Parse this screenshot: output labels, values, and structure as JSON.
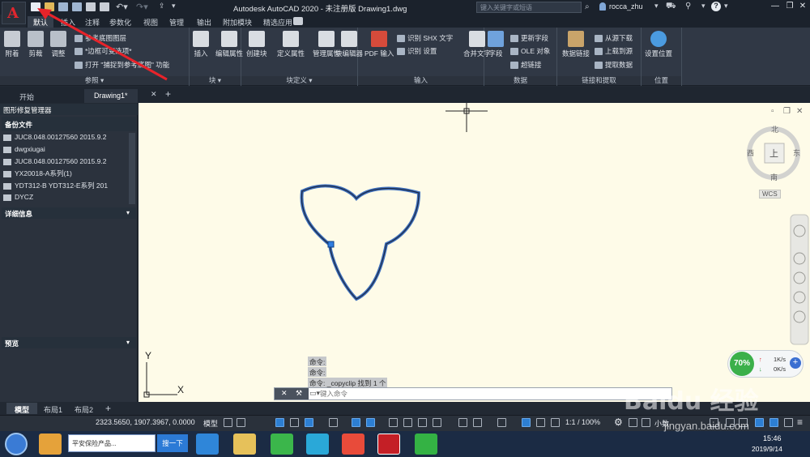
{
  "title": {
    "app_title": "Autodesk AutoCAD 2020 - 未注册版    Drawing1.dwg",
    "search_placeholder": "键入关键字或短语",
    "user": "rocca_zhu"
  },
  "ribbon_tabs": [
    "默认",
    "插入",
    "注释",
    "参数化",
    "视图",
    "管理",
    "输出",
    "附加模块",
    "精选应用"
  ],
  "ribbon": {
    "reference": {
      "title": "参照",
      "attach": "附着",
      "clip": "剪裁",
      "adjust": "调整",
      "underlay_layers": "参考底图图层",
      "frames": "*边框可变选项*",
      "snap": "打开 \"捕捉到参考底图\" 功能"
    },
    "block": {
      "title": "块",
      "insert": "插入",
      "edit_attributes": "编辑属性"
    },
    "block_def": {
      "title": "块定义",
      "create": "创建块",
      "define_attributes": "定义属性",
      "manage_attributes": "管理属性",
      "block_editor": "块编辑器"
    },
    "import": {
      "title": "输入",
      "pdf_import": "PDF 输入",
      "recognize_shx": "识别 SHX 文字",
      "recognize_settings": "识别 设置",
      "combine_text": "合并文字"
    },
    "data": {
      "title": "数据",
      "field": "字段",
      "update_fields": "更新字段",
      "ole_object": "OLE 对象",
      "hyperlink": "超链接"
    },
    "link_extract": {
      "title": "链接和提取",
      "data_link": "数据链接",
      "download": "从源下载",
      "upload": "上载到源",
      "extract": "提取数据"
    },
    "location": {
      "title": "位置",
      "set_location": "设置位置"
    }
  },
  "doc_tabs": [
    "开始",
    "Drawing1*"
  ],
  "drawing_recovery": {
    "title": "图形修复管理器",
    "backup_header": "备份文件",
    "files": [
      "JUC8.048.00127560 2015.9.2",
      "dwgxiugai",
      "JUC8.048.00127560 2015.9.2",
      "YX20018-A系列(1)",
      "YDT312-B YDT312-E系列 201",
      "DYCZ"
    ],
    "details_header": "详细信息",
    "preview_header": "预览"
  },
  "viewcube": {
    "north": "北",
    "south": "南",
    "east": "东",
    "west": "西",
    "top": "上",
    "wcs": "WCS"
  },
  "ucs": {
    "x": "X",
    "y": "Y"
  },
  "command": {
    "history": [
      "命令:",
      "命令:",
      "命令: _copyclip 找到 1 个"
    ],
    "placeholder": "键入命令"
  },
  "layout_tabs": [
    "模型",
    "布局1",
    "布局2"
  ],
  "status": {
    "coords": "2323.5650, 1907.3967, 0.0000",
    "model": "模型",
    "scale": "1:1 / 100%",
    "decimal": "小数"
  },
  "taskbar": {
    "search_text": "平安保险产品...",
    "search_button": "搜一下",
    "time": "15:46",
    "date": "2019/9/14"
  },
  "network": {
    "percent": "70%",
    "up": "1K/s",
    "down": "0K/s"
  },
  "watermark": {
    "brand": "Baidu 经验",
    "url": "jingyan.baidu.com"
  }
}
